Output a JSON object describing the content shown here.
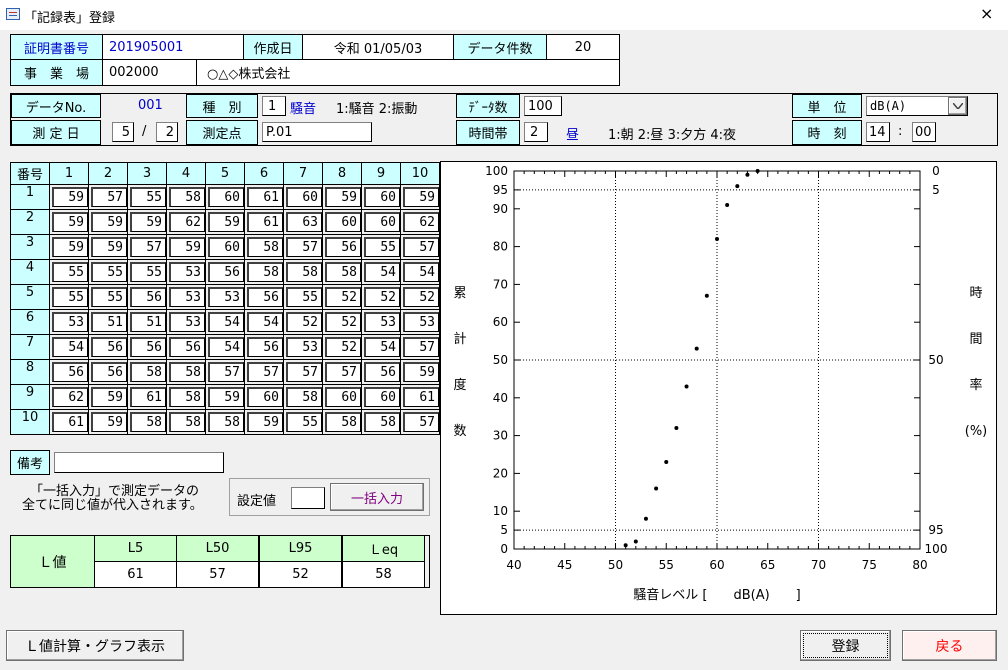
{
  "window": {
    "title": "「記録表」登録",
    "close_icon": "×"
  },
  "header": {
    "cert_label": "証明書番号",
    "cert_value": "201905001",
    "created_label": "作成日",
    "created_value": "令和 01/05/03",
    "count_label": "データ件数",
    "count_value": "20",
    "site_label": "事　業　場",
    "site_code": "002000",
    "site_name": "○△◇株式会社"
  },
  "meta": {
    "data_no_label": "データNo.",
    "data_no_value": "001",
    "kind_label": "種　別",
    "kind_code": "1",
    "kind_name": "騒音",
    "kind_hint": "1:騒音 2:振動",
    "data_count_label": "ﾃﾞｰﾀ数",
    "data_count_value": "100",
    "unit_label": "単　位",
    "unit_value": "dB(A)",
    "date_label": "測 定 日",
    "month": "5",
    "date_sep": "/",
    "day": "2",
    "point_label": "測定点",
    "point_value": "P.01",
    "period_label": "時間帯",
    "period_code": "2",
    "period_name": "昼",
    "period_hint": "1:朝 2:昼 3:夕方 4:夜",
    "time_label": "時　刻",
    "hour": "14",
    "time_sep": ":",
    "minute": "00"
  },
  "grid": {
    "corner": "番号",
    "cols": [
      "1",
      "2",
      "3",
      "4",
      "5",
      "6",
      "7",
      "8",
      "9",
      "10"
    ],
    "rows": [
      {
        "no": "1",
        "v": [
          "59",
          "57",
          "55",
          "58",
          "60",
          "61",
          "60",
          "59",
          "60",
          "59"
        ]
      },
      {
        "no": "2",
        "v": [
          "59",
          "59",
          "59",
          "62",
          "59",
          "61",
          "63",
          "60",
          "60",
          "62"
        ]
      },
      {
        "no": "3",
        "v": [
          "59",
          "59",
          "57",
          "59",
          "60",
          "58",
          "57",
          "56",
          "55",
          "57"
        ]
      },
      {
        "no": "4",
        "v": [
          "55",
          "55",
          "55",
          "53",
          "56",
          "58",
          "58",
          "58",
          "54",
          "54"
        ]
      },
      {
        "no": "5",
        "v": [
          "55",
          "55",
          "56",
          "53",
          "53",
          "56",
          "55",
          "52",
          "52",
          "52"
        ]
      },
      {
        "no": "6",
        "v": [
          "53",
          "51",
          "51",
          "53",
          "54",
          "54",
          "52",
          "52",
          "53",
          "53"
        ]
      },
      {
        "no": "7",
        "v": [
          "54",
          "56",
          "56",
          "56",
          "54",
          "56",
          "53",
          "52",
          "54",
          "57"
        ]
      },
      {
        "no": "8",
        "v": [
          "56",
          "56",
          "58",
          "58",
          "57",
          "57",
          "57",
          "57",
          "56",
          "59"
        ]
      },
      {
        "no": "9",
        "v": [
          "62",
          "59",
          "61",
          "58",
          "59",
          "60",
          "58",
          "60",
          "60",
          "61"
        ]
      },
      {
        "no": "10",
        "v": [
          "61",
          "59",
          "58",
          "58",
          "58",
          "59",
          "55",
          "58",
          "58",
          "57"
        ]
      }
    ],
    "remarks_label": "備考",
    "remarks_value": ""
  },
  "bulk": {
    "note_line1": "「一括入力」で測定データの",
    "note_line2": "全てに同じ値が代入されます。",
    "setting_label": "設定値",
    "setting_value": "",
    "button": "一括入力"
  },
  "lvalues": {
    "label": "Ｌ値",
    "headers": [
      "L5",
      "L50",
      "L95",
      "Ｌeq"
    ],
    "values": [
      "61",
      "57",
      "52",
      "58"
    ]
  },
  "buttons": {
    "calc": "Ｌ値計算・グラフ表示",
    "register": "登録",
    "back": "戻る"
  },
  "colors": {
    "cyan": "#ccffff",
    "blue_text": "#0000cc",
    "back_red": "#ff0000",
    "back_bg": "#fff0f0"
  },
  "chart_data": {
    "type": "scatter",
    "title": "",
    "xlabel": "騒音レベル [　　dB(A)　　]",
    "ylabel_left": [
      "累",
      "計",
      "度",
      "数"
    ],
    "ylabel_right": [
      "時",
      "間",
      "率",
      "(%)"
    ],
    "xlim": [
      40,
      80
    ],
    "ylim": [
      0,
      100
    ],
    "xticks": [
      "40",
      "45",
      "50",
      "55",
      "60",
      "65",
      "70",
      "75",
      "80"
    ],
    "yticks_left": [
      "0",
      "5",
      "10",
      "20",
      "30",
      "40",
      "50",
      "60",
      "70",
      "80",
      "90",
      "95",
      "100"
    ],
    "yticks_right": [
      "100",
      "95",
      "50",
      "5",
      "0"
    ],
    "grid_dotted": {
      "x": [
        50,
        60,
        70
      ],
      "y": [
        5,
        50,
        95
      ]
    },
    "points": [
      {
        "x": 51,
        "y": 1
      },
      {
        "x": 52,
        "y": 2
      },
      {
        "x": 53,
        "y": 8
      },
      {
        "x": 54,
        "y": 16
      },
      {
        "x": 55,
        "y": 23
      },
      {
        "x": 56,
        "y": 32
      },
      {
        "x": 57,
        "y": 43
      },
      {
        "x": 58,
        "y": 53
      },
      {
        "x": 59,
        "y": 67
      },
      {
        "x": 60,
        "y": 82
      },
      {
        "x": 61,
        "y": 91
      },
      {
        "x": 62,
        "y": 96
      },
      {
        "x": 63,
        "y": 99
      },
      {
        "x": 64,
        "y": 100
      }
    ]
  }
}
